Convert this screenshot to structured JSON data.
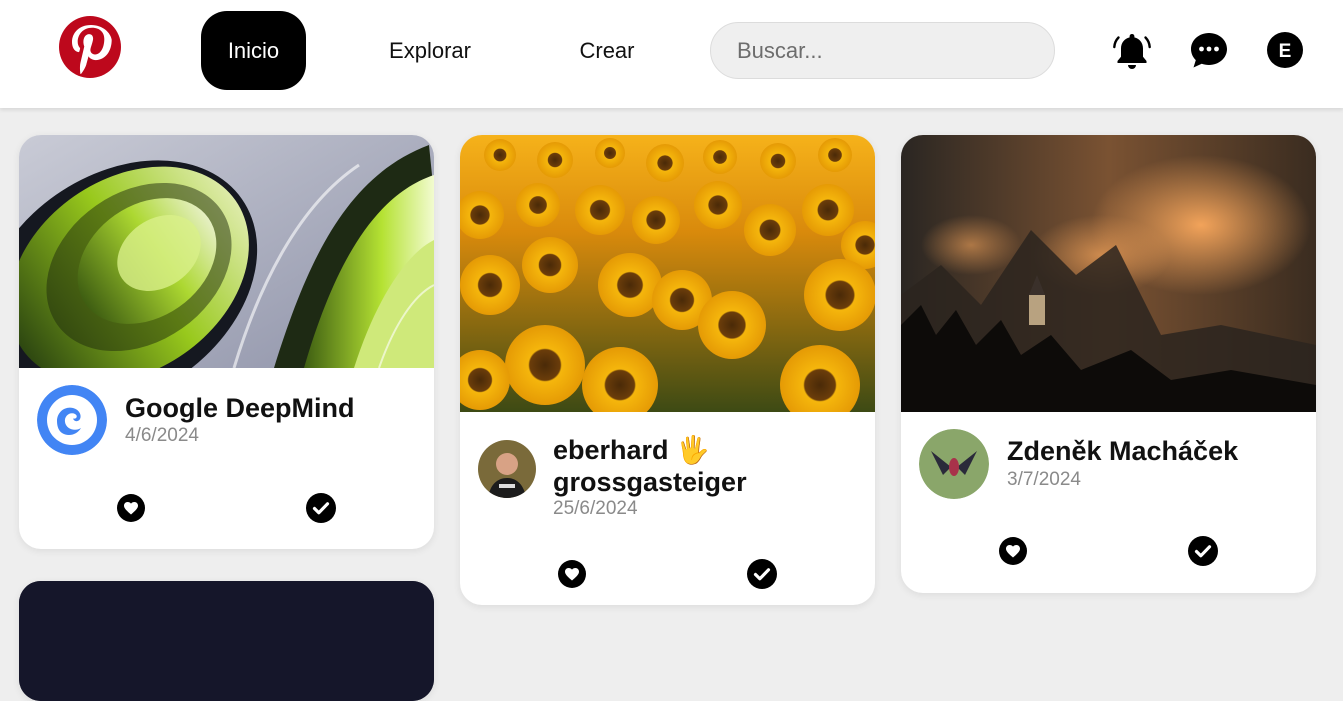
{
  "header": {
    "nav": [
      {
        "label": "Inicio",
        "active": true
      },
      {
        "label": "Explorar",
        "active": false
      },
      {
        "label": "Crear",
        "active": false
      }
    ],
    "search": {
      "placeholder": "Buscar...",
      "value": ""
    },
    "icons": [
      "pinterest-logo-icon",
      "bell-icon",
      "messages-icon",
      "profile-icon"
    ],
    "profile_initial": "E",
    "brand_color": "#bd081c"
  },
  "pins": [
    {
      "author": "Google DeepMind",
      "date": "4/6/2024",
      "image": "abstract green glass 3D render",
      "actions": [
        "heart-icon",
        "check-icon"
      ]
    },
    {
      "author": "eberhard 🖐 grossgasteiger",
      "date": "25/6/2024",
      "image": "sunflower field",
      "actions": [
        "heart-icon",
        "check-icon"
      ]
    },
    {
      "author": "Zdeněk Macháček",
      "date": "3/7/2024",
      "image": "misty mountain church at sunset",
      "actions": [
        "heart-icon",
        "check-icon"
      ]
    }
  ]
}
